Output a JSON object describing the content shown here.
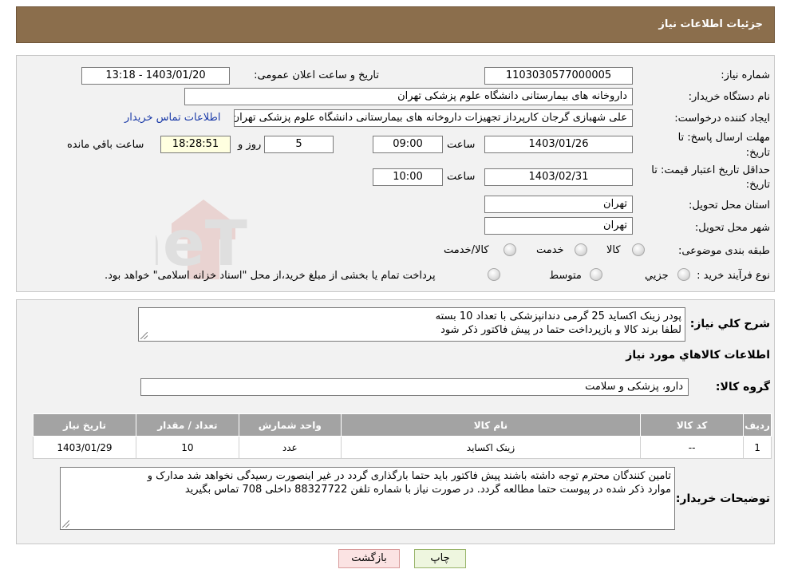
{
  "header": {
    "title": "جزئیات اطلاعات نیاز"
  },
  "fields": {
    "need_number_label": "شماره نیاز:",
    "need_number": "1103030577000005",
    "announce_label": "تاریخ و ساعت اعلان عمومی:",
    "announce_value": "1403/01/20 - 13:18",
    "buyer_org_label": "نام دستگاه خریدار:",
    "buyer_org": "داروخانه های بیمارستانی دانشگاه علوم پزشکی تهران",
    "creator_label": "ایجاد کننده درخواست:",
    "creator": "علی شهبازی گرجان کارپرداز تجهیزات داروخانه های بیمارستانی دانشگاه علوم پزشکی تهران",
    "contact_link": "اطلاعات تماس خریدار",
    "deadline_label_1": "مهلت ارسال پاسخ: تا",
    "deadline_label_2": "تاریخ:",
    "deadline_date": "1403/01/26",
    "time_label": "ساعت",
    "deadline_time": "09:00",
    "days_value": "5",
    "days_label": "روز و",
    "remaining_time": "18:28:51",
    "remaining_label": "ساعت باقي مانده",
    "price_validity_label_1": "حداقل تاریخ اعتبار قیمت: تا",
    "price_validity_label_2": "تاریخ:",
    "price_validity_date": "1403/02/31",
    "price_validity_time": "10:00",
    "province_label": "استان محل تحویل:",
    "province": "تهران",
    "city_label": "شهر محل تحویل:",
    "city": "تهران",
    "category_label": "طبقه بندی موضوعی:",
    "category_options": [
      "کالا",
      "خدمت",
      "کالا/خدمت"
    ],
    "process_label": "نوع فرآیند خرید :",
    "process_options": [
      "جزیي",
      "متوسط"
    ],
    "process_note": "پرداخت تمام یا بخشی از مبلغ خرید،از محل \"اسناد خزانه اسلامی\" خواهد بود."
  },
  "summary": {
    "label": "شرح كلي نياز:",
    "lines": [
      "پودر زینک اکساید 25 گرمی دندانپزشکی با تعداد 10 بسته",
      "لطفا برند کالا و بازپرداخت حتما در پیش فاکتور ذکر شود"
    ]
  },
  "goods_section_title": "اطلاعات كالاهاي مورد نياز",
  "goods_group": {
    "label": "گروه کالا:",
    "value": "دارو، پزشکی و سلامت"
  },
  "table": {
    "headers": [
      "رديف",
      "کد کالا",
      "نام کالا",
      "واحد شمارش",
      "تعداد / مقدار",
      "تاریخ نیاز"
    ],
    "rows": [
      [
        "1",
        "--",
        "زینک اکساید",
        "عدد",
        "10",
        "1403/01/29"
      ]
    ]
  },
  "buyer_notes": {
    "label": "توضیحات خریدار:",
    "lines": [
      "تامین کنندگان محترم توجه داشته باشند پیش فاکتور باید حتما بارگذاری گردد در غیر اینصورت رسیدگی نخواهد شد مدارک و",
      "موارد ذکر شده در پیوست حتما مطالعه گردد. در صورت نیاز با شماره تلفن 88327722 داخلی 708 تماس بگیرید"
    ]
  },
  "buttons": {
    "print": "چاپ",
    "back": "بازگشت"
  },
  "watermark": "AriaTender.neT",
  "colors": {
    "header_bg": "#8b6e4c",
    "table_header_bg": "#a3a3a3",
    "link": "#1a3aa8"
  }
}
